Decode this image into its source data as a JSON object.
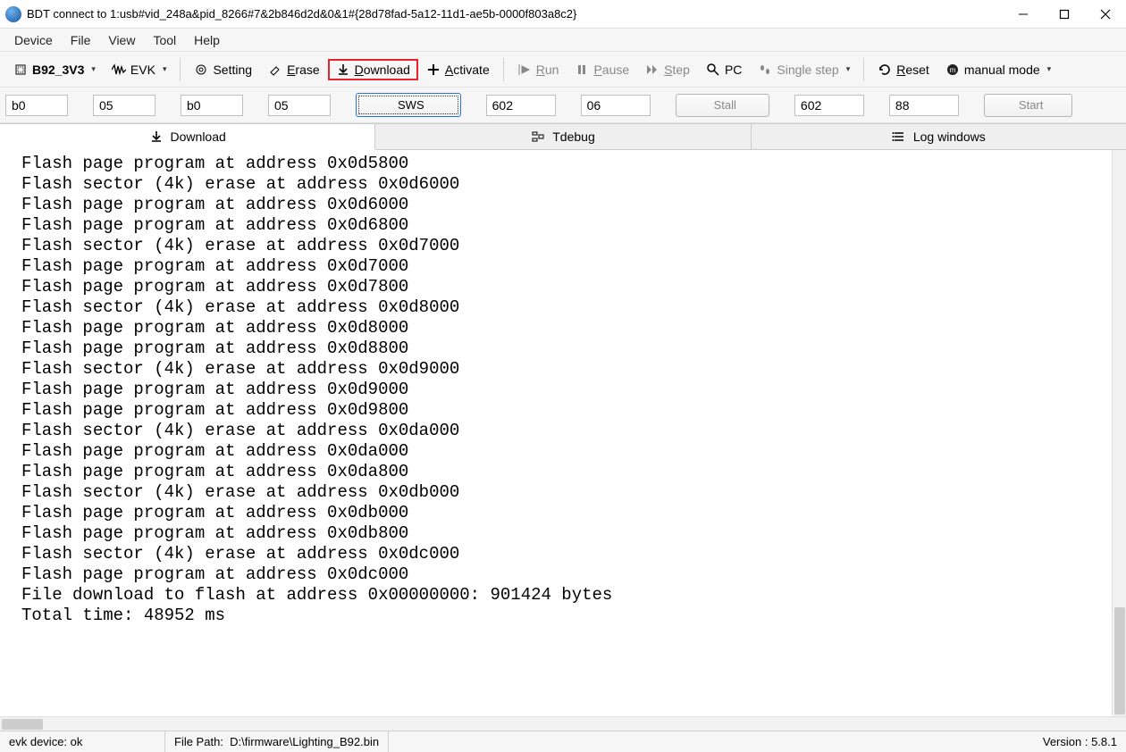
{
  "title": "BDT connect to 1:usb#vid_248a&pid_8266#7&2b846d2d&0&1#{28d78fad-5a12-11d1-ae5b-0000f803a8c2}",
  "menu": [
    "Device",
    "File",
    "View",
    "Tool",
    "Help"
  ],
  "toolbar": {
    "chip": "B92_3V3",
    "board": "EVK",
    "setting": "Setting",
    "erase_u": "E",
    "erase_rest": "rase",
    "download_u": "D",
    "download_rest": "ownload",
    "activate_u": "A",
    "activate_rest": "ctivate",
    "run_u": "R",
    "run_rest": "un",
    "pause_u": "P",
    "pause_rest": "ause",
    "step_u": "S",
    "step_rest": "tep",
    "pc": "PC",
    "singlestep": "Single step",
    "reset_u": "R",
    "reset_rest": "eset",
    "manual": "manual mode"
  },
  "inputs": {
    "a1": "b0",
    "a2": "05",
    "b1": "b0",
    "b2": "05",
    "sws": "SWS",
    "c1": "602",
    "c2": "06",
    "stall": "Stall",
    "d1": "602",
    "d2": "88",
    "start": "Start"
  },
  "tabs": {
    "download": "Download",
    "tdebug": "Tdebug",
    "log": "Log windows"
  },
  "log_lines": [
    "Flash page program at address 0x0d5800",
    "Flash sector (4k) erase at address 0x0d6000",
    "Flash page program at address 0x0d6000",
    "Flash page program at address 0x0d6800",
    "Flash sector (4k) erase at address 0x0d7000",
    "Flash page program at address 0x0d7000",
    "Flash page program at address 0x0d7800",
    "Flash sector (4k) erase at address 0x0d8000",
    "Flash page program at address 0x0d8000",
    "Flash page program at address 0x0d8800",
    "Flash sector (4k) erase at address 0x0d9000",
    "Flash page program at address 0x0d9000",
    "Flash page program at address 0x0d9800",
    "Flash sector (4k) erase at address 0x0da000",
    "Flash page program at address 0x0da000",
    "Flash page program at address 0x0da800",
    "Flash sector (4k) erase at address 0x0db000",
    "Flash page program at address 0x0db000",
    "Flash page program at address 0x0db800",
    "Flash sector (4k) erase at address 0x0dc000",
    "Flash page program at address 0x0dc000",
    "File download to flash at address 0x00000000: 901424 bytes",
    "Total time: 48952 ms"
  ],
  "status": {
    "device": "evk device: ok",
    "path_label": "File Path:",
    "path_value": "D:\\firmware\\Lighting_B92.bin",
    "version": "Version : 5.8.1"
  }
}
